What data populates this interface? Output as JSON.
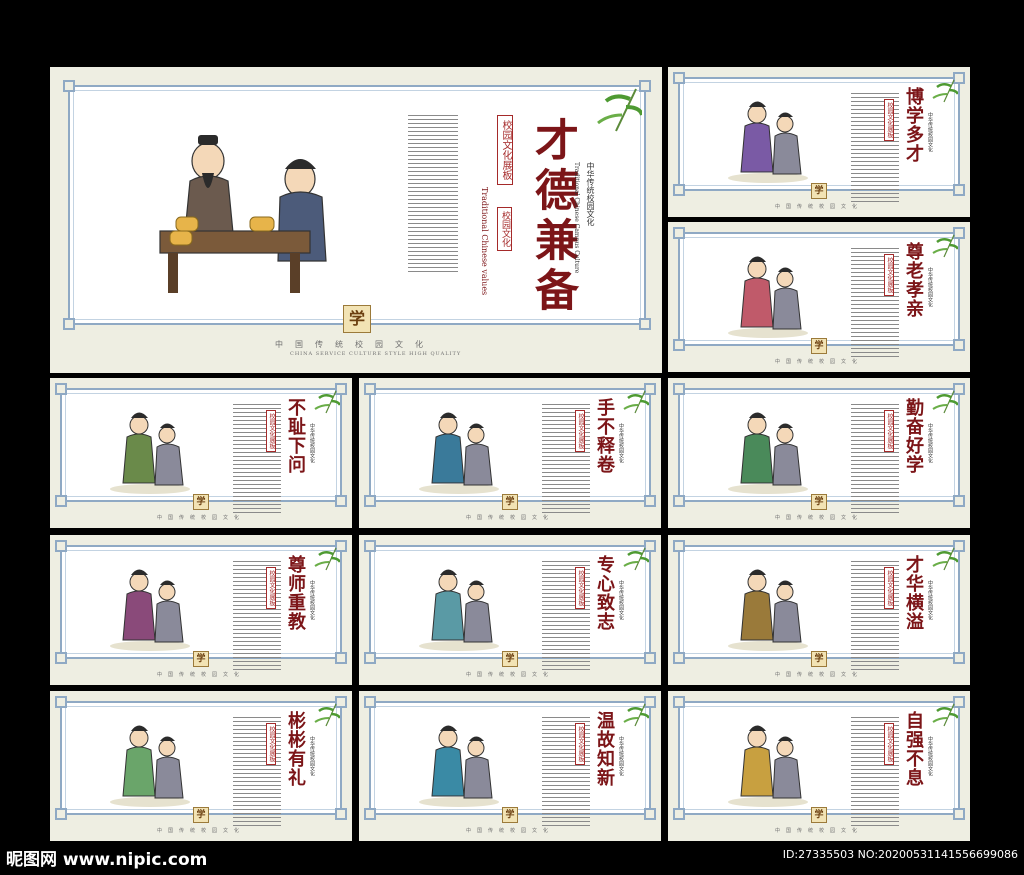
{
  "main": {
    "title": "才德兼备",
    "tag_top": "校园文化展板",
    "tag_mid": "校园文化",
    "tag_en": "Traditional Chinese values",
    "tag_en2": "Four ple",
    "vertical_small_1": "中华传统校园文化",
    "vertical_small_2": "Traditional Chinese Campus Culture",
    "xue": "学",
    "footer_cn": "中国传统校园文化",
    "footer_en": "CHINA SERVICE CULTURE STYLE HIGH QUALITY"
  },
  "panels": [
    {
      "title": "博学多才"
    },
    {
      "title": "尊老孝亲"
    },
    {
      "title": "不耻下问"
    },
    {
      "title": "手不释卷"
    },
    {
      "title": "勤奋好学"
    },
    {
      "title": "尊师重教"
    },
    {
      "title": "专心致志"
    },
    {
      "title": "才华横溢"
    },
    {
      "title": "彬彬有礼"
    },
    {
      "title": "温故知新"
    },
    {
      "title": "自强不息"
    }
  ],
  "common": {
    "xue": "学",
    "footer_cn": "中国传统校园文化",
    "seal": "校园文化展板",
    "side_small": "中华传统校园文化"
  },
  "credits": {
    "left": "昵图网 www.nipic.com",
    "right": "ID:27335503 NO:20200531141556699086"
  },
  "colors": {
    "title": "#7c1518",
    "frame": "#8fa9c4",
    "board": "#eeeee2",
    "background": "#000000"
  }
}
